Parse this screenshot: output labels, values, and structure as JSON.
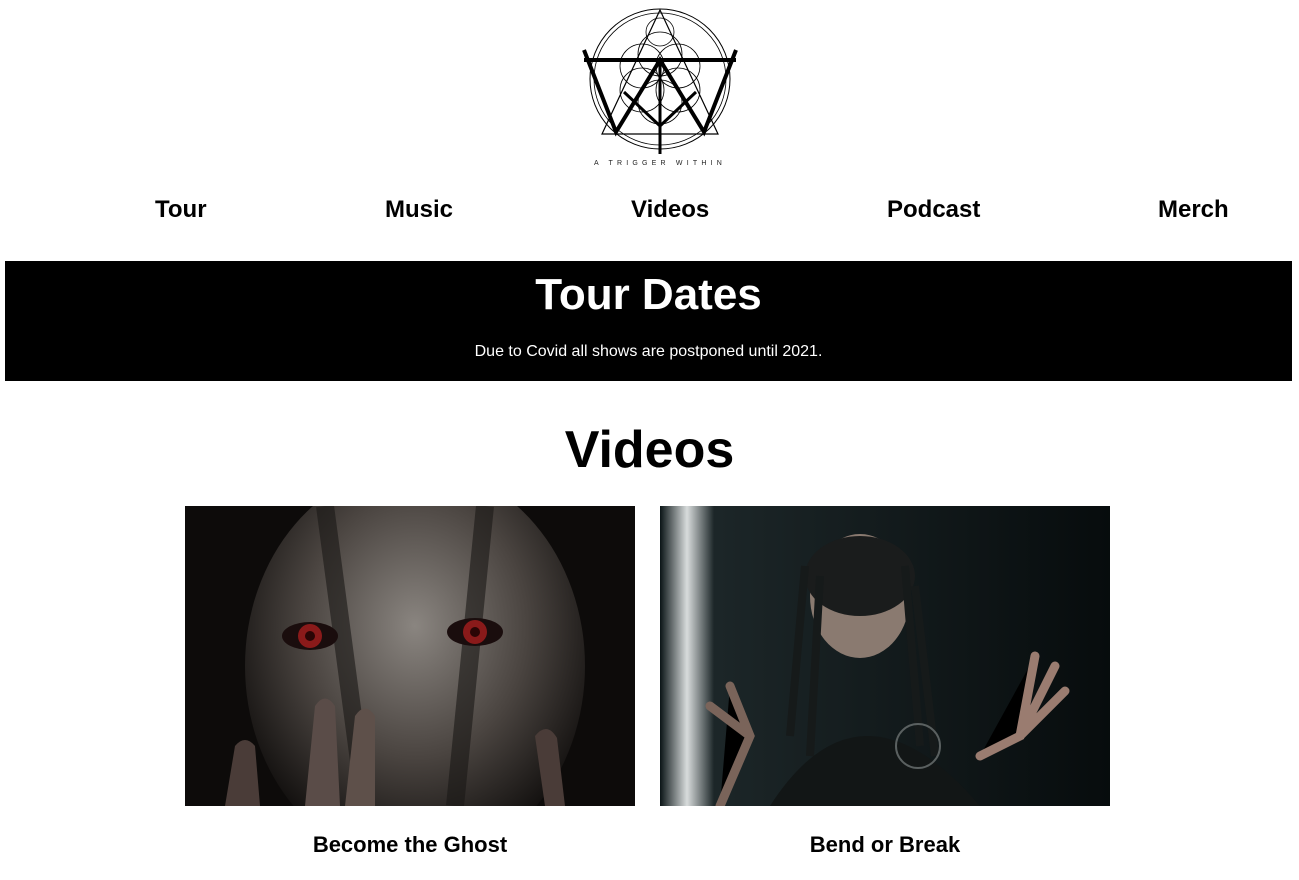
{
  "logo": {
    "text": "A TRIGGER WITHIN",
    "icon": "sacred-geometry-logo-icon"
  },
  "nav": {
    "items": [
      {
        "label": "Tour"
      },
      {
        "label": "Music"
      },
      {
        "label": "Videos"
      },
      {
        "label": "Podcast"
      },
      {
        "label": "Merch"
      }
    ]
  },
  "tour": {
    "title": "Tour Dates",
    "note": "Due to Covid all shows are postponed until 2021."
  },
  "videos": {
    "title": "Videos",
    "items": [
      {
        "caption": "Become the Ghost",
        "thumb": "masked-face-red-eyes-thumbnail"
      },
      {
        "caption": "Bend or Break",
        "thumb": "singer-dreadlocks-thumbnail"
      }
    ]
  },
  "colors": {
    "background": "#ffffff",
    "banner": "#000000",
    "text": "#000000",
    "banner_text": "#ffffff"
  }
}
